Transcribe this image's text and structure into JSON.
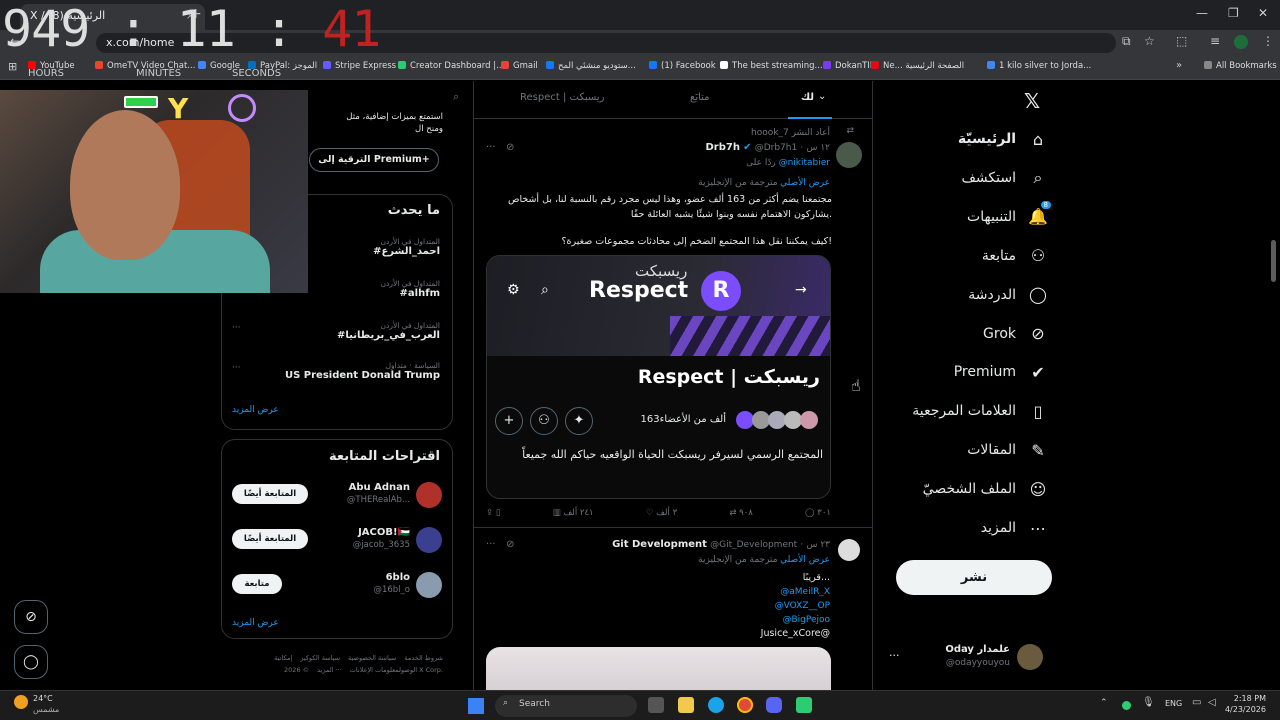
{
  "browser": {
    "tab_title": "X / (8) الرئيسية",
    "address": "x.com/home",
    "bookmarks": [
      {
        "label": "YouTube",
        "color": "#ff0000"
      },
      {
        "label": "OmeTV Video Chat...",
        "color": "#e8452c"
      },
      {
        "label": "Google",
        "color": "#4285f4"
      },
      {
        "label": "PayPal: الموجز",
        "color": "#0070ba"
      },
      {
        "label": "Stripe Express",
        "color": "#635bff"
      },
      {
        "label": "Creator Dashboard |...",
        "color": "#2ecc71"
      },
      {
        "label": "Gmail",
        "color": "#ea4335"
      },
      {
        "label": "ستوديو منشئي المح...",
        "color": "#1877f2"
      },
      {
        "label": "(1) Facebook",
        "color": "#1877f2"
      },
      {
        "label": "The best streaming...",
        "color": "#ffffff"
      },
      {
        "label": "DokanTIP",
        "color": "#7c3aed"
      },
      {
        "label": "Ne... الصفحة الرئيسية",
        "color": "#e50914"
      },
      {
        "label": "1 kilo silver to Jorda...",
        "color": "#4285f4"
      }
    ],
    "all_bookmarks": "All Bookmarks"
  },
  "clock_overlay": {
    "hours": "949",
    "minutes": "11",
    "seconds": "41",
    "labels": [
      "HOURS",
      "MINUTES",
      "SECONDS"
    ]
  },
  "sidebar": {
    "items": [
      {
        "label": "الرئيسيّة",
        "icon": "home-icon"
      },
      {
        "label": "استكشف",
        "icon": "search-icon"
      },
      {
        "label": "التنبيهات",
        "icon": "bell-icon",
        "badge": "8"
      },
      {
        "label": "متابعة",
        "icon": "person-plus-icon"
      },
      {
        "label": "الدردشة",
        "icon": "chat-icon"
      },
      {
        "label": "Grok",
        "icon": "grok-icon"
      },
      {
        "label": "Premium",
        "icon": "verified-icon"
      },
      {
        "label": "العلامات المرجعية",
        "icon": "bookmark-icon"
      },
      {
        "label": "المقالات",
        "icon": "article-icon"
      },
      {
        "label": "الملف الشخصيّ",
        "icon": "profile-icon"
      },
      {
        "label": "المزيد",
        "icon": "more-icon"
      }
    ],
    "post_button": "نشر",
    "account": {
      "name": "Oday علمدار",
      "handle": "@odayyouyou",
      "more": "..."
    }
  },
  "feed": {
    "tabs": [
      "لك",
      "متابَع",
      "Respect | ريسبكت"
    ],
    "tweet1": {
      "repost": "hoook_7 أعاد النشر",
      "author": "Drb7h",
      "handle": "@Drb7h1",
      "time": "١٢ س",
      "reply_to": "ردًا على",
      "reply_handle": "@nikitabier",
      "translated": "مترجمة من الإنجليزية",
      "original": "عرض الأصلي",
      "text1": "مجتمعنا يضم أكثر من 163 ألف عضو، وهذا ليس مجرد رقم بالنسبة لنا، بل أشخاص يشاركون الاهتمام نفسه وبنوا شيئًا يشبه العائلة حقًا.",
      "text2": "كيف يمكننا نقل هذا المجتمع الضخم إلى محادثات مجموعات صغيرة؟!",
      "card": {
        "banner_text": "Respect",
        "banner_ar": "ريسبكت",
        "logo": "R",
        "title": "Respect | ريسبكت",
        "members": "163ألف من الأعضاء",
        "desc": "المجتمع الرسمي لسيرفر ريسبكت الحياة الواقعيه حياكم الله جميعاً"
      },
      "stats": {
        "replies": "٣٠١",
        "reposts": "٩٠٨",
        "likes": "٣ ألف",
        "views": "٢٤١ ألف"
      }
    },
    "tweet2": {
      "author": "Git Development",
      "handle": "@Git_Development",
      "time": "٢٣ س",
      "translated": "مترجمة من الإنجليزية",
      "original": "عرض الأصلي",
      "lines": [
        "قريبًا...",
        "@aMeilR_X",
        "@VOXZ__OP",
        "@BigPejoo",
        "Jusice_xCore@"
      ]
    }
  },
  "right": {
    "premium": {
      "line1": "استمتع بميزات إضافية، مثل",
      "line2": "ومنح ال",
      "button": "الترقية إلى Premium+"
    },
    "trends_title": "ما يحدث",
    "trends": [
      {
        "sub": "المتداول في الأردن",
        "name": "#احمد_الشرع"
      },
      {
        "sub": "المتداول في الأردن",
        "name": "#alhfm"
      },
      {
        "sub": "المتداول في الأردن",
        "name": "#العرب_في_بريطانيا"
      },
      {
        "sub": "السياسة · متداول",
        "name": "US President Donald Trump"
      }
    ],
    "show_more": "عرض المزيد",
    "who_title": "اقتراحات المتابعة",
    "who": [
      {
        "name": "Abu Adnan",
        "handle": "@THERealAb...",
        "button": "المتابعة أيضًا",
        "color": "#b0302a"
      },
      {
        "name": "JACOB!🇵🇸",
        "handle": "@jacob_3635",
        "button": "المتابعة أيضًا",
        "color": "#3a3f8f"
      },
      {
        "name": "6blo",
        "handle": "@16bl_o",
        "button": "متابعة",
        "color": "#8a9bb0"
      }
    ],
    "who_more": "عرض المزيد",
    "footer": [
      "شروط الخدمة",
      "سياسة الخصوصية",
      "سياسة الكوكيز",
      "إمكانية الوصول",
      "معلومات الإعلانات",
      "··· المزيد",
      "© 2026 X Corp."
    ]
  },
  "taskbar": {
    "weather_temp": "24°C",
    "weather_desc": "مشمس",
    "search": "Search",
    "lang": "ENG",
    "time": "2:18 PM",
    "date": "4/23/2026"
  }
}
